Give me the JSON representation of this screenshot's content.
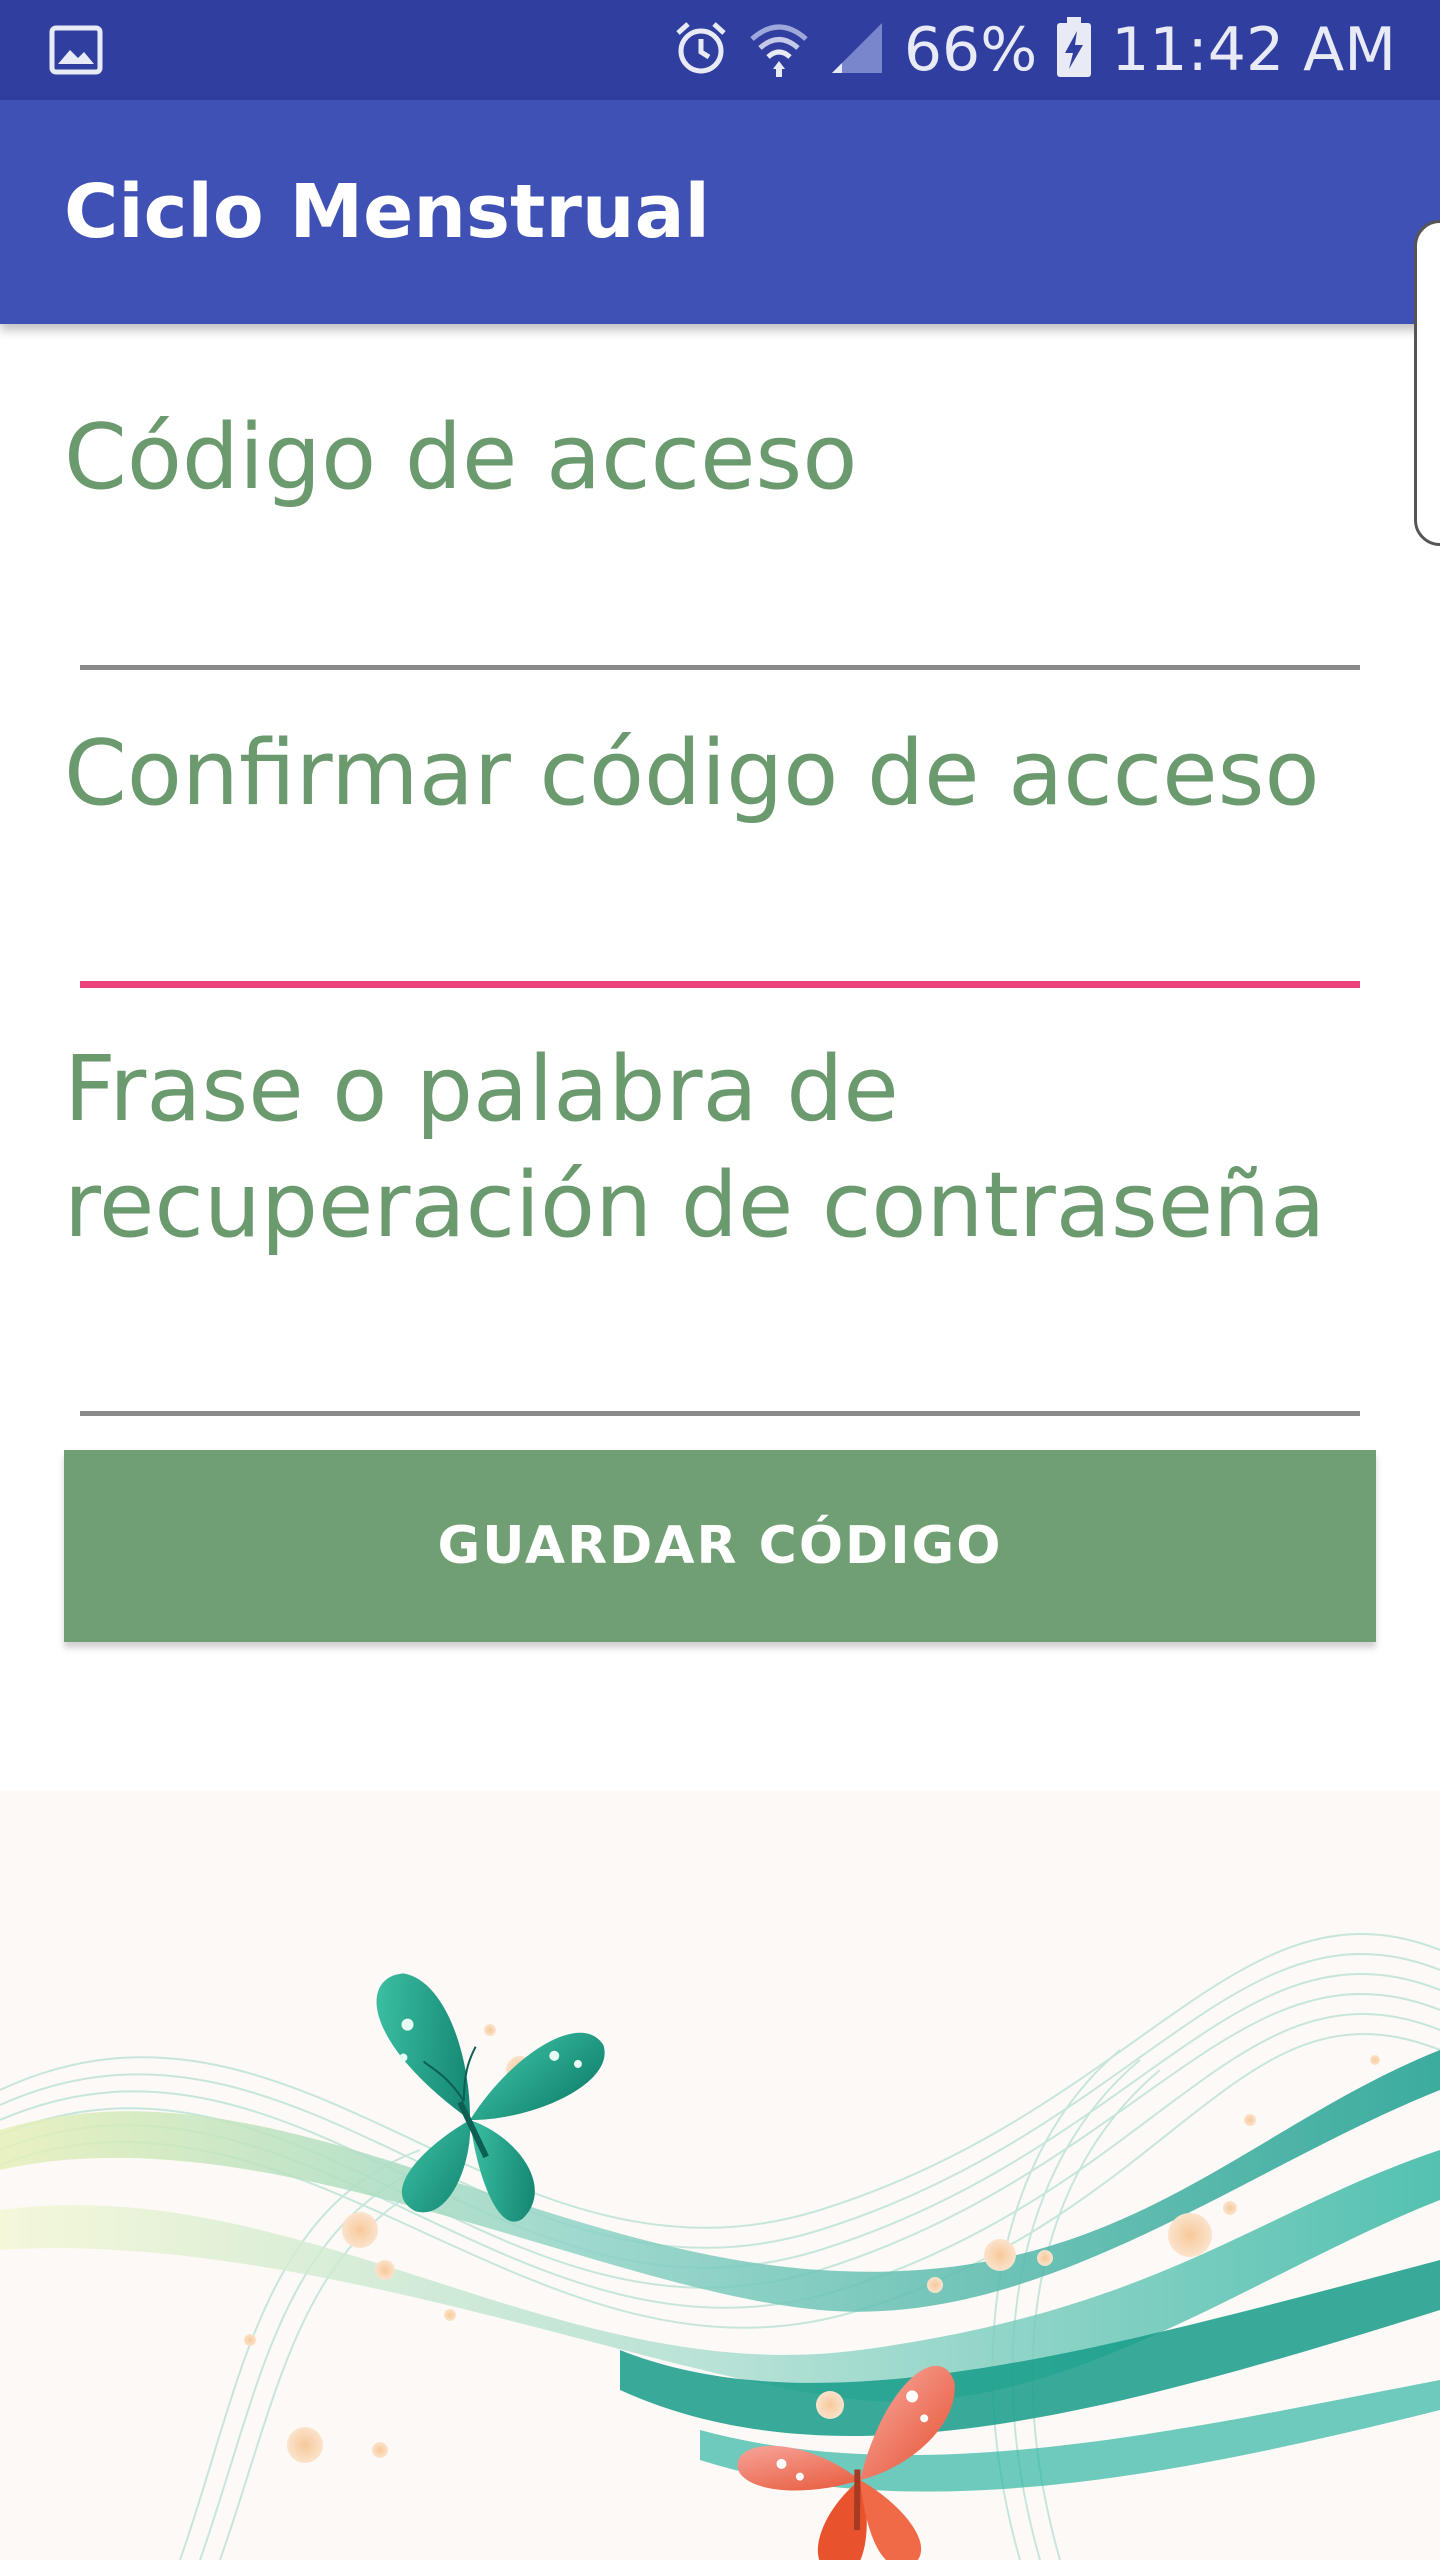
{
  "status_bar": {
    "battery": "66%",
    "time": "11:42 AM",
    "icons": [
      "gallery-icon",
      "alarm-icon",
      "wifi-icon",
      "signal-icon",
      "battery-charging-icon"
    ]
  },
  "app_bar": {
    "title": "Ciclo Menstrual",
    "color": "#3f51b5"
  },
  "form": {
    "access_code": {
      "label": "Código de acceso",
      "value": ""
    },
    "confirm_code": {
      "label": "Confirmar código de acceso",
      "value": "",
      "focused": true
    },
    "recovery_phrase": {
      "label_line1": "Frase o palabra de",
      "label_line2": "recuperación de contraseña",
      "value": ""
    },
    "save_button": "GUARDAR CÓDIGO"
  },
  "colors": {
    "status_bar": "#303f9f",
    "label_green": "#6a9a6e",
    "button_green": "#6f9f72",
    "focus_accent": "#ec407a"
  }
}
